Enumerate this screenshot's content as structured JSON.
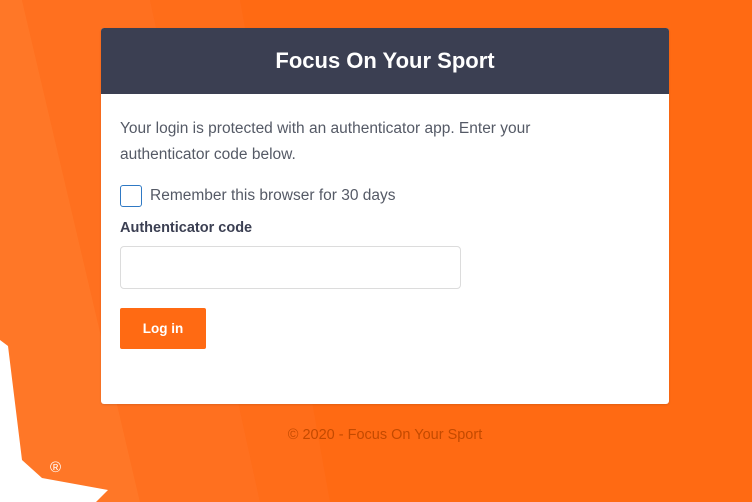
{
  "colors": {
    "background": "#ff6a13",
    "header": "#3b3f52",
    "accent": "#ff6a13"
  },
  "card": {
    "title": "Focus On Your Sport",
    "intro": "Your login is protected with an authenticator app. Enter your authenticator code below.",
    "remember_label": "Remember this browser for 30 days",
    "remember_checked": false,
    "code_label": "Authenticator code",
    "code_value": "",
    "code_placeholder": "",
    "login_label": "Log in"
  },
  "footer": {
    "text": "© 2020 - Focus On Your Sport"
  },
  "brand": {
    "registered_mark": "®",
    "logo_icon": "brand-stripe-logo-icon"
  }
}
